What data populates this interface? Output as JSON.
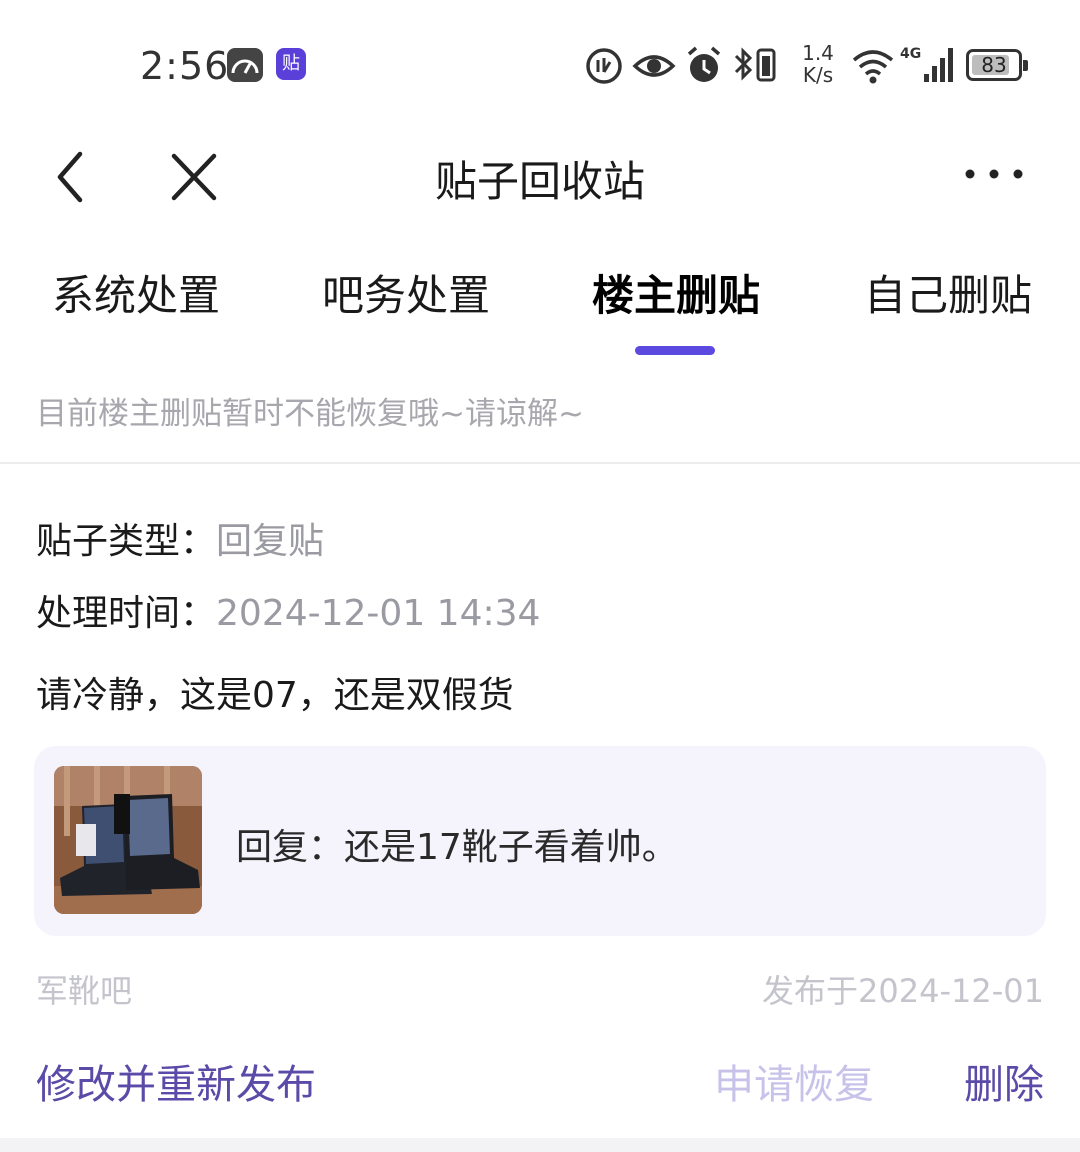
{
  "status_bar": {
    "time": "2:56",
    "app_badge": "贴",
    "network_speed_value": "1.4",
    "network_speed_unit": "K/s",
    "network_type": "4G",
    "battery_level": "83",
    "battery_fraction": 0.83
  },
  "nav": {
    "title": "贴子回收站"
  },
  "tabs": [
    {
      "label": "系统处置",
      "active": false
    },
    {
      "label": "吧务处置",
      "active": false
    },
    {
      "label": "楼主删贴",
      "active": true
    },
    {
      "label": "自己删贴",
      "active": false
    }
  ],
  "notice": "目前楼主删贴暂时不能恢复哦~请谅解~",
  "post": {
    "type_label": "贴子类型：",
    "type_value": "回复贴",
    "time_label": "处理时间：",
    "time_value": "2024-12-01 14:34",
    "content": "请冷静，这是07，还是双假货",
    "quote": "回复：还是17靴子看着帅。",
    "forum": "军靴吧",
    "published": "发布于2024-12-01"
  },
  "actions": {
    "edit_label": "修改并重新发布",
    "restore_label": "申请恢复",
    "delete_label": "删除"
  },
  "colors": {
    "accent": "#5b49e0",
    "action_text": "#5b4aa8",
    "action_disabled": "#c7c2ea",
    "card_bg": "#f5f4fc",
    "muted_text": "#a7a7ad"
  },
  "icons": {
    "back": "chevron-left-icon",
    "close": "close-icon",
    "more": "more-dots-icon"
  }
}
